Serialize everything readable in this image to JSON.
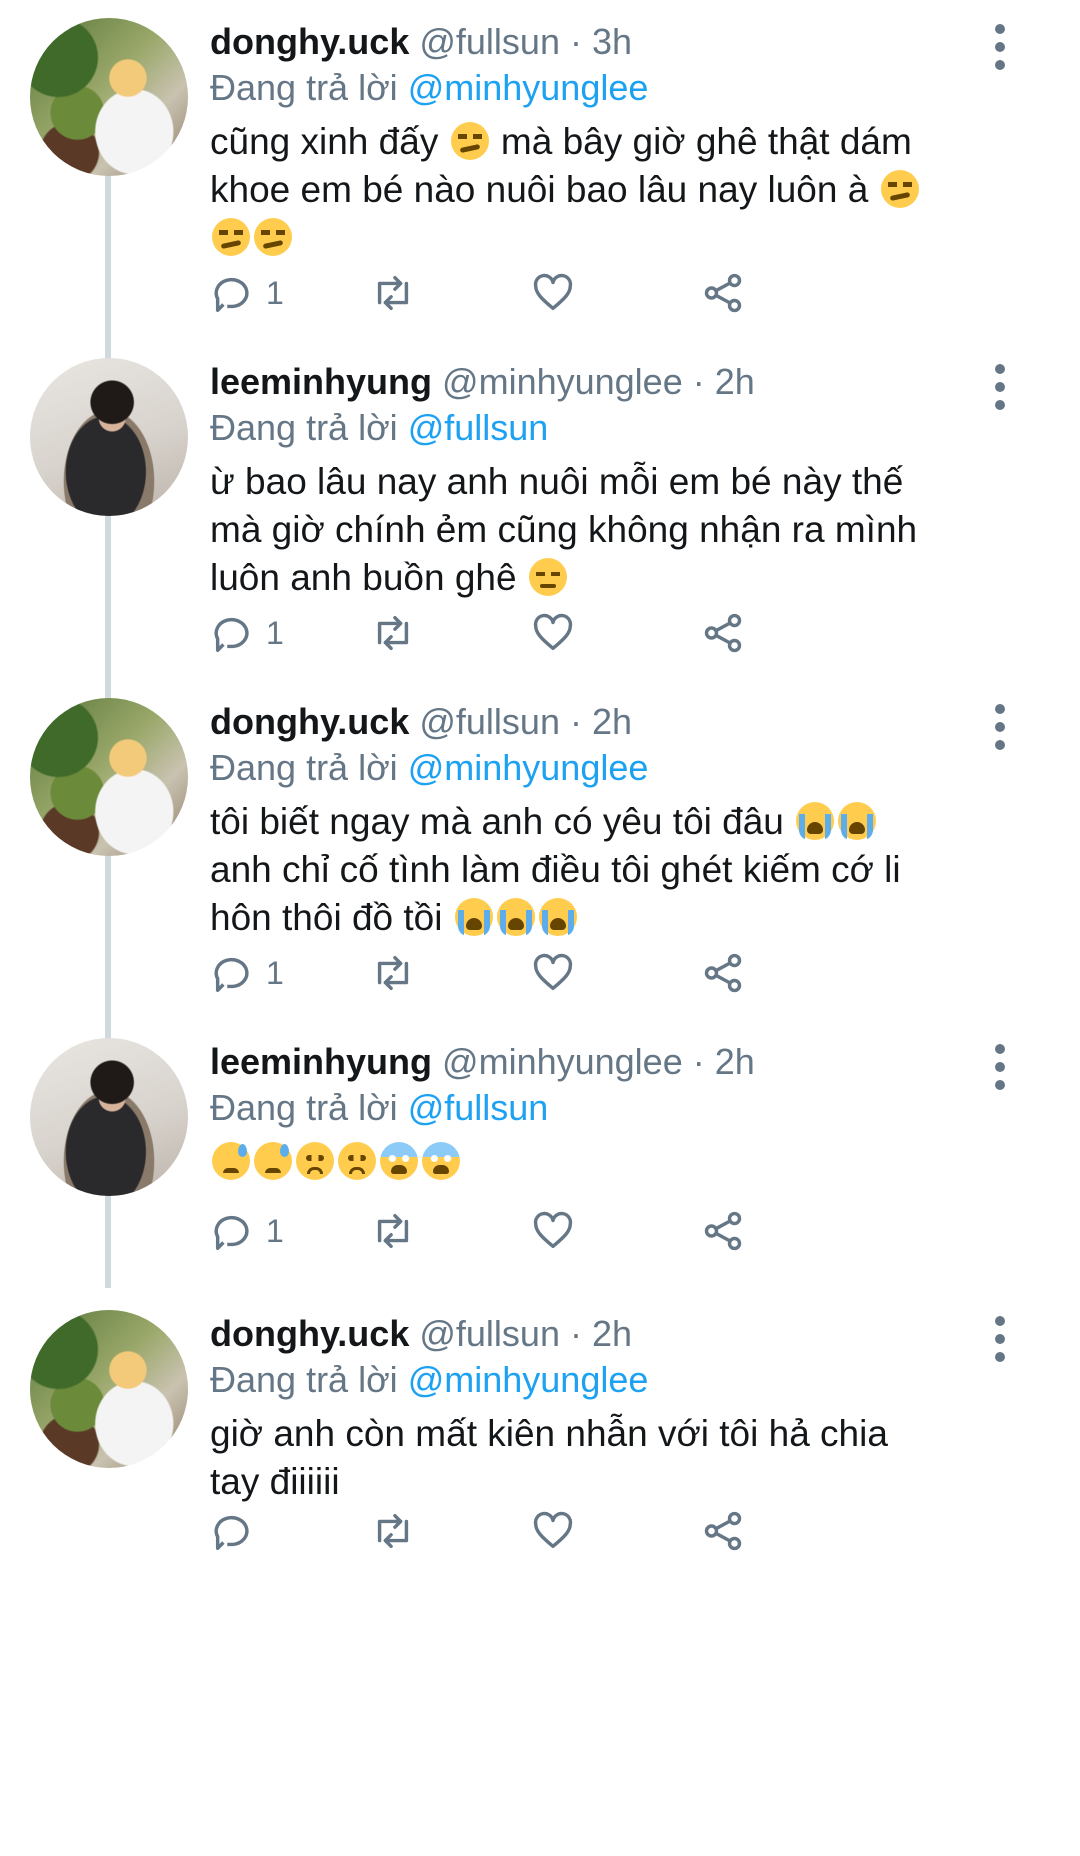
{
  "tweets": [
    {
      "name": "donghy.uck",
      "handle": "@fullsun",
      "time": "· 3h",
      "replying_prefix": "Đang trả lời",
      "replying_to": "@minhyunglee",
      "lines": [
        [
          "cũng xinh đấy ",
          {
            "emoji": "smirk"
          },
          " mà bây giờ ghê thật dám"
        ],
        [
          "khoe em bé nào nuôi bao lâu nay luôn à ",
          {
            "emoji": "smirk"
          }
        ],
        [
          {
            "emoji": "smirk"
          },
          {
            "emoji": "smirk"
          }
        ]
      ],
      "reply_count": "1",
      "avatar": "donghy-avatar"
    },
    {
      "name": "leeminhyung",
      "handle": "@minhyunglee",
      "time": "· 2h",
      "replying_prefix": "Đang trả lời",
      "replying_to": "@fullsun",
      "lines": [
        [
          "ừ bao lâu nay anh nuôi mỗi em bé này thế"
        ],
        [
          "mà giờ chính ẻm cũng không nhận ra mình"
        ],
        [
          "luôn anh buồn ghê ",
          {
            "emoji": "pensive"
          }
        ]
      ],
      "reply_count": "1",
      "avatar": "minhyung-avatar"
    },
    {
      "name": "donghy.uck",
      "handle": "@fullsun",
      "time": "· 2h",
      "replying_prefix": "Đang trả lời",
      "replying_to": "@minhyunglee",
      "lines": [
        [
          "tôi biết ngay mà anh có yêu tôi đâu ",
          {
            "emoji": "sob"
          },
          {
            "emoji": "sob"
          }
        ],
        [
          "anh chỉ cố tình làm điều tôi ghét kiếm cớ li"
        ],
        [
          "hôn thôi đồ tồi ",
          {
            "emoji": "sob"
          },
          {
            "emoji": "sob"
          },
          {
            "emoji": "sob"
          }
        ]
      ],
      "reply_count": "1",
      "avatar": "donghy-avatar"
    },
    {
      "name": "leeminhyung",
      "handle": "@minhyunglee",
      "time": "· 2h",
      "replying_prefix": "Đang trả lời",
      "replying_to": "@fullsun",
      "lines": [
        [
          {
            "emoji": "sweat"
          },
          {
            "emoji": "sweat"
          },
          {
            "emoji": "sad"
          },
          {
            "emoji": "sad"
          },
          {
            "emoji": "fear"
          },
          {
            "emoji": "fear"
          }
        ]
      ],
      "reply_count": "1",
      "avatar": "minhyung-avatar"
    },
    {
      "name": "donghy.uck",
      "handle": "@fullsun",
      "time": "· 2h",
      "replying_prefix": "Đang trả lời",
      "replying_to": "@minhyunglee",
      "lines": [
        [
          "giờ anh còn mất kiên nhẫn với tôi hả chia"
        ],
        [
          "tay điiiiii"
        ]
      ],
      "reply_count": "",
      "avatar": "donghy-avatar"
    }
  ],
  "colors": {
    "text": "#14171a",
    "secondary": "#657786",
    "accent": "#1da1f2",
    "thread_line": "#cfd9de"
  },
  "icons": [
    "reply-icon",
    "retweet-icon",
    "like-icon",
    "share-icon",
    "more-options-icon"
  ]
}
